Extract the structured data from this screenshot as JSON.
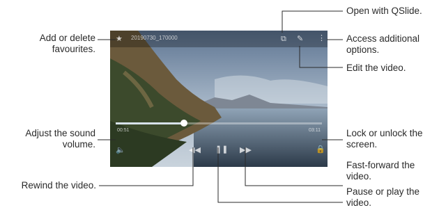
{
  "player": {
    "video_title": "20190730_170000",
    "elapsed_time": "00:51",
    "total_time": "03:11",
    "progress": 0.33
  },
  "icons": {
    "favourite": "star-icon",
    "qslide": "qslide-icon",
    "edit": "pencil-icon",
    "more": "more-options-icon",
    "volume": "speaker-icon",
    "rewind": "rewind-icon",
    "play_pause": "pause-icon",
    "fast_forward": "fast-forward-icon",
    "lock": "lock-icon"
  },
  "callouts": {
    "favourites": [
      "Add or delete",
      "favourites."
    ],
    "volume": [
      "Adjust the sound",
      "volume."
    ],
    "rewind": [
      "Rewind the video."
    ],
    "qslide": [
      "Open with QSlide."
    ],
    "options": [
      "Access additional",
      "options."
    ],
    "edit": [
      "Edit the video."
    ],
    "lock": [
      "Lock or unlock the",
      "screen."
    ],
    "fast_forward": [
      "Fast-forward the",
      "video."
    ],
    "pause": [
      "Pause or play the",
      "video."
    ]
  }
}
